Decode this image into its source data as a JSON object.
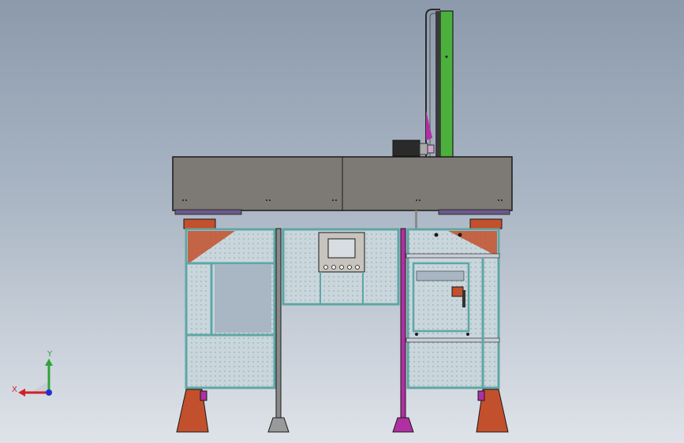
{
  "viewport": {
    "background_top": "#8c9aac",
    "background_bottom": "#dfe3e9"
  },
  "model": {
    "frame_color": "#5fa6a6",
    "mesh_color": "#c9d6dc",
    "table_color": "#7d7a75",
    "leg_color": "#c2502c",
    "upright_color": "#4cb03c",
    "accent_color": "#b02fa2",
    "motor_color": "#2a2a2a"
  },
  "triad": {
    "x_label": "X",
    "y_label": "Y",
    "x_color": "#d0202a",
    "y_color": "#2ea43a",
    "z_color": "#2030d0"
  }
}
